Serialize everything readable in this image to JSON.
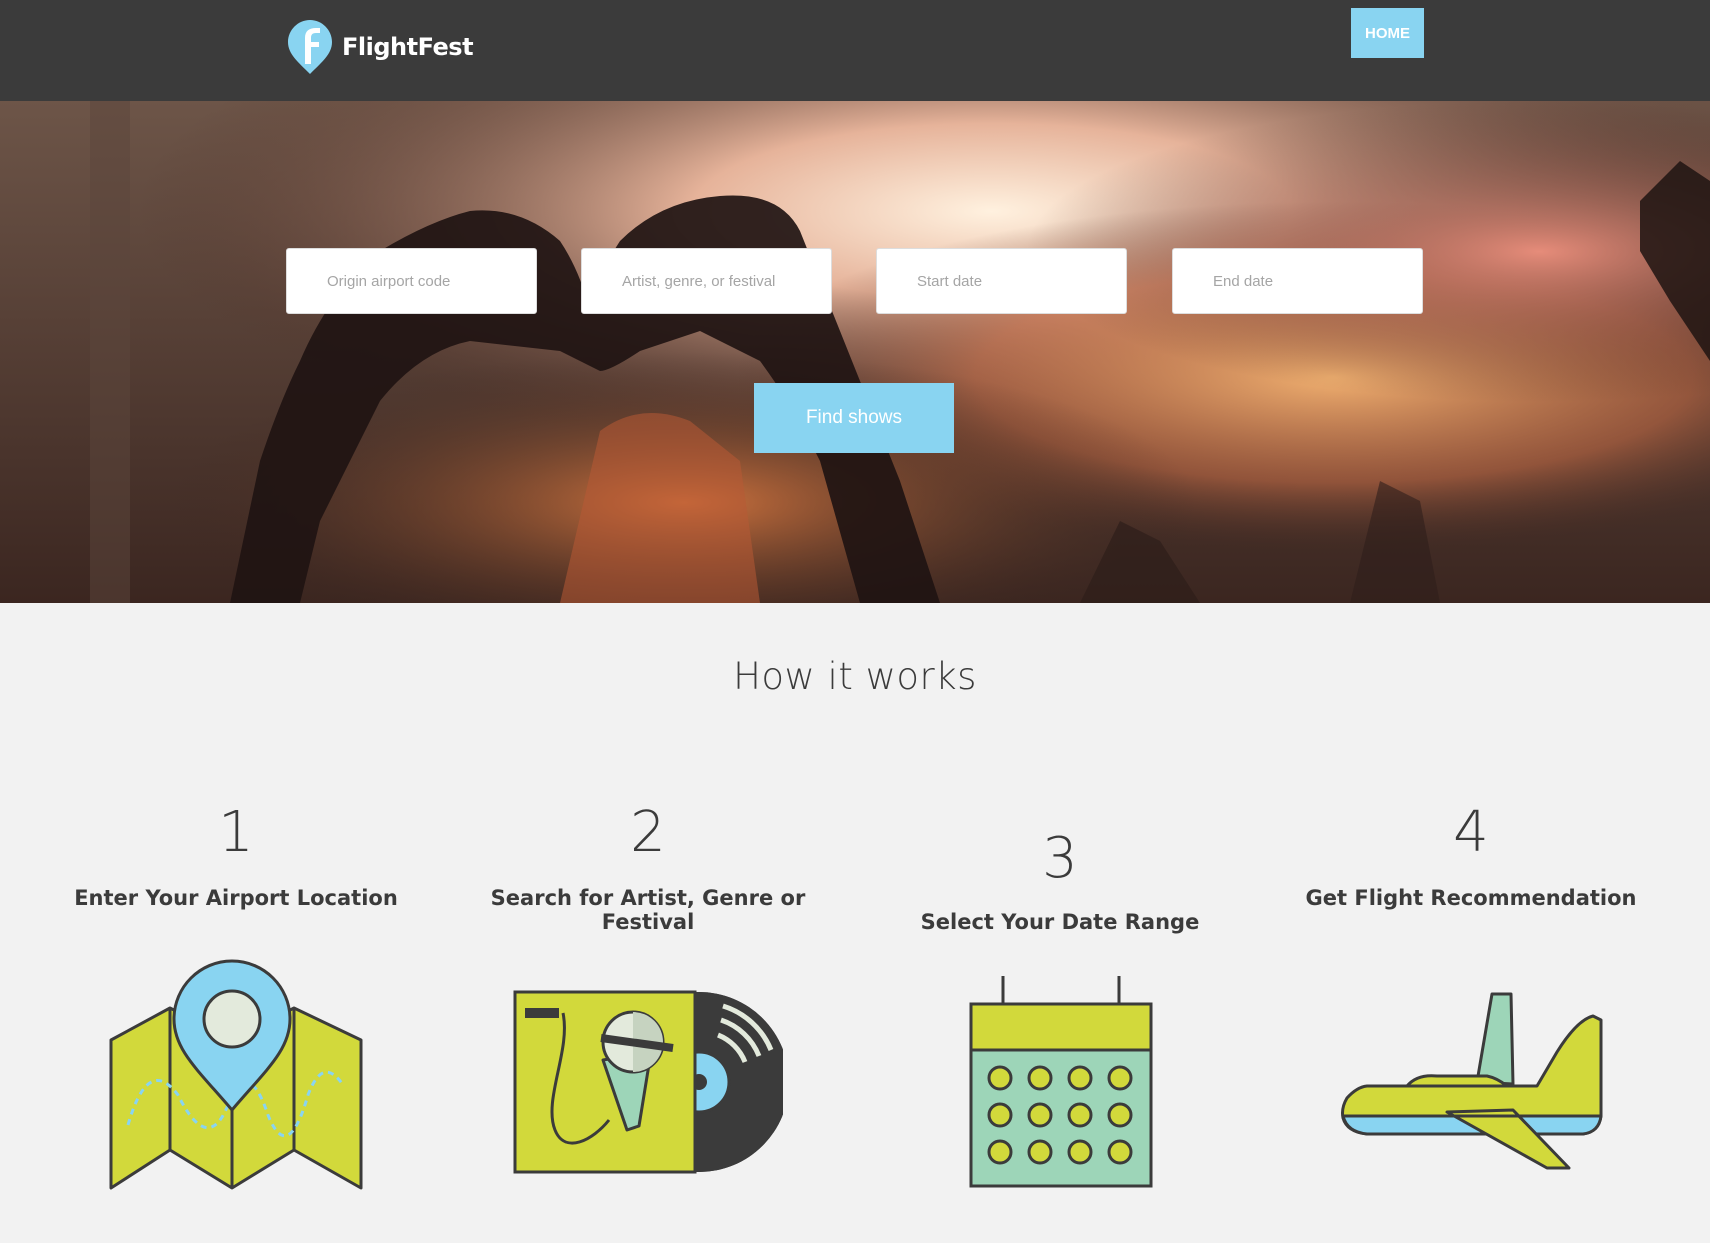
{
  "nav": {
    "brand": "FlightFest",
    "home_label": "HOME",
    "accent_color": "#89d4f1",
    "background_color": "#3b3b3b"
  },
  "search": {
    "origin_placeholder": "Origin airport code",
    "artist_placeholder": "Artist, genre, or festival",
    "start_placeholder": "Start date",
    "end_placeholder": "End date",
    "submit_label": "Find shows"
  },
  "how_it_works": {
    "title": "How it works",
    "steps": [
      {
        "number": "1",
        "title": "Enter Your Airport Location",
        "icon": "map-pin-icon"
      },
      {
        "number": "2",
        "title": "Search for Artist, Genre or Festival",
        "icon": "microphone-record-icon"
      },
      {
        "number": "3",
        "title": "Select Your Date Range",
        "icon": "calendar-icon"
      },
      {
        "number": "4",
        "title": "Get Flight Recommendation",
        "icon": "airplane-icon"
      }
    ]
  },
  "colors": {
    "lime": "#d2d93b",
    "sky": "#89d4f1",
    "mint": "#9dd5b8",
    "outline": "#3b3b3b",
    "page_bg": "#f2f2f2"
  }
}
